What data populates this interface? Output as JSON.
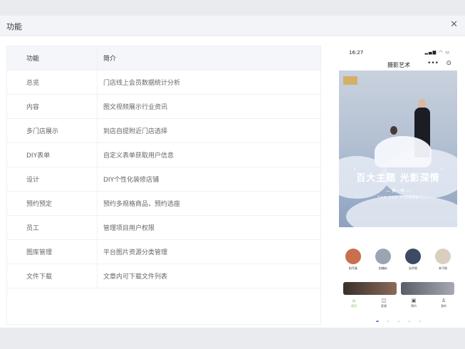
{
  "dialog": {
    "title": "功能",
    "close_icon": "✕"
  },
  "table": {
    "headers": [
      "功能",
      "简介"
    ],
    "rows": [
      {
        "name": "总览",
        "desc": "门店线上会员数据统计分析"
      },
      {
        "name": "内容",
        "desc": "图文视频展示行业资讯"
      },
      {
        "name": "多门店展示",
        "desc": "到店自提附近门店选择"
      },
      {
        "name": "DIY表单",
        "desc": "自定义表单获取用户信息"
      },
      {
        "name": "设计",
        "desc": "DIY个性化装修店铺"
      },
      {
        "name": "预约预定",
        "desc": "预约多规格商品，预约选座"
      },
      {
        "name": "员工",
        "desc": "管理项目用户权限"
      },
      {
        "name": "图库管理",
        "desc": "平台图片资源分类管理"
      },
      {
        "name": "文件下载",
        "desc": "文章内可下载文件列表"
      }
    ]
  },
  "phone": {
    "time": "16:27",
    "status_icons": "signal-wifi-battery",
    "nav_title": "摄影艺术",
    "nav_more": "•••",
    "nav_target": "⊙",
    "banner": {
      "main_text": "百大主题 光影深情",
      "sub_text": "— 第一季 —",
      "en_text": "TOP 100 THEMES",
      "left_arrow": "‹",
      "right_arrow": "›"
    },
    "categories": [
      {
        "label": "拍写真",
        "color": "#c86f4e"
      },
      {
        "label": "拍婚纱",
        "color": "#9aa4b2"
      },
      {
        "label": "证件照",
        "color": "#3d4a63"
      },
      {
        "label": "亲子照",
        "color": "#d9cfc0"
      }
    ],
    "tabs": [
      {
        "label": "首页",
        "icon": "⌂",
        "color": "#7fbf6a"
      },
      {
        "label": "套餐",
        "icon": "◫",
        "color": "#555"
      },
      {
        "label": "预约",
        "icon": "▣",
        "color": "#555"
      },
      {
        "label": "我的",
        "icon": "♙",
        "color": "#555"
      }
    ],
    "pager": {
      "count": 5,
      "active": 0
    }
  },
  "colors": {
    "accent": "#7b6fd9",
    "header_bg": "#f4f6fa",
    "page_bg": "#e9ebef"
  }
}
